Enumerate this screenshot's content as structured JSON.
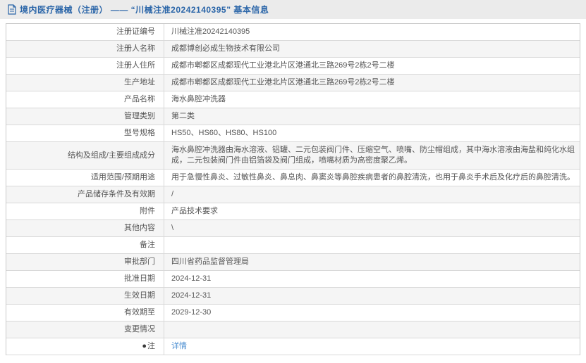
{
  "colors": {
    "accent_blue": "#2a65a8",
    "link_blue": "#4d8fd1",
    "topbar_bg": "#ebebeb",
    "stripe": "#f5f5f5",
    "border": "#c9c9c9",
    "text": "#555555"
  },
  "header": {
    "icon": "document-icon",
    "title": "境内医疗器械（注册） —— “川械注准20242140395” 基本信息"
  },
  "table": {
    "note_icon_glyph": "●",
    "rows": [
      {
        "label": "注册证编号",
        "value": "川械注准20242140395"
      },
      {
        "label": "注册人名称",
        "value": "成都博创必成生物技术有限公司"
      },
      {
        "label": "注册人住所",
        "value": "成都市郫都区成都现代工业港北片区港通北三路269号2栋2号二楼"
      },
      {
        "label": "生产地址",
        "value": "成都市郫都区成都现代工业港北片区港通北三路269号2栋2号二楼"
      },
      {
        "label": "产品名称",
        "value": "海水鼻腔冲洗器"
      },
      {
        "label": "管理类别",
        "value": "第二类"
      },
      {
        "label": "型号规格",
        "value": "HS50、HS60、HS80、HS100"
      },
      {
        "label": "结构及组成/主要组成成分",
        "value": "海水鼻腔冲洗器由海水溶液、铝罐、二元包装阀门件、压缩空气、喷嘴、防尘帽组成，其中海水溶液由海盐和纯化水组成，二元包装阀门件由铝箔袋及阀门组成，喷嘴材质为高密度聚乙烯。"
      },
      {
        "label": "适用范围/预期用途",
        "value": "用于急慢性鼻炎、过敏性鼻炎、鼻息肉、鼻窦炎等鼻腔疾病患者的鼻腔清洗，也用于鼻炎手术后及化疗后的鼻腔清洗。"
      },
      {
        "label": "产品储存条件及有效期",
        "value": "/"
      },
      {
        "label": "附件",
        "value": "产品技术要求"
      },
      {
        "label": "其他内容",
        "value": "\\"
      },
      {
        "label": "备注",
        "value": ""
      },
      {
        "label": "审批部门",
        "value": "四川省药品监督管理局"
      },
      {
        "label": "批准日期",
        "value": "2024-12-31"
      },
      {
        "label": "生效日期",
        "value": "2024-12-31"
      },
      {
        "label": "有效期至",
        "value": "2029-12-30"
      },
      {
        "label": "变更情况",
        "value": ""
      },
      {
        "label": "注",
        "value": "详情"
      }
    ]
  }
}
